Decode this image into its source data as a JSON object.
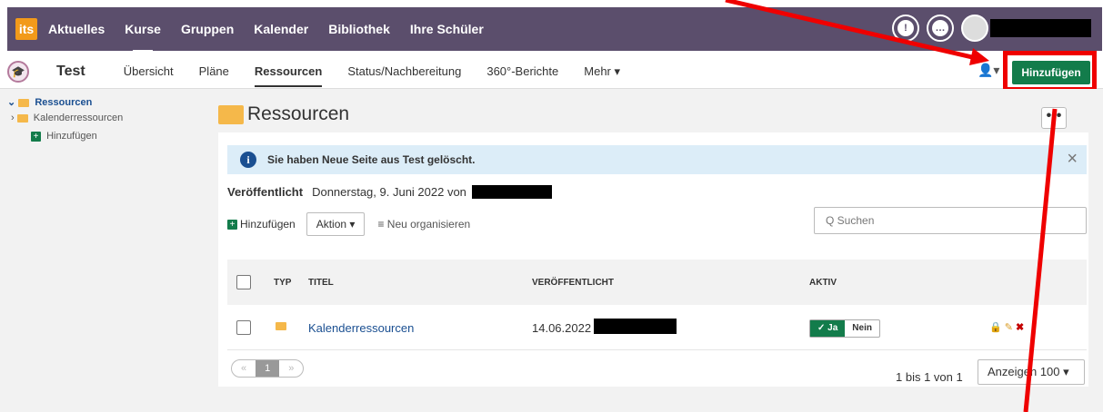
{
  "topnav": {
    "logo": "its",
    "items": [
      "Aktuelles",
      "Kurse",
      "Gruppen",
      "Kalender",
      "Bibliothek",
      "Ihre Schüler"
    ],
    "icons": [
      "bell-icon",
      "chat-icon"
    ]
  },
  "subnav": {
    "course_icon": "graduation-cap-icon",
    "course_title": "Test",
    "tabs": [
      "Übersicht",
      "Pläne",
      "Ressourcen",
      "Status/Nachbereitung",
      "360°-Berichte",
      "Mehr ▾"
    ],
    "active_tab": "Ressourcen",
    "user_menu": "user-dropdown-icon",
    "add_button": "Hinzufügen"
  },
  "sidebar": {
    "root": "Ressourcen",
    "child": "Kalenderressourcen",
    "add": "Hinzufügen"
  },
  "main": {
    "title": "Ressourcen",
    "more": "•••",
    "alert": "Sie haben Neue Seite aus Test gelöscht.",
    "alert_close": "×",
    "published_label": "Veröffentlicht",
    "published_text": "Donnerstag, 9. Juni 2022 von",
    "toolbar": {
      "add": "Hinzufügen",
      "action": "Aktion ▾",
      "reorg": "≡ Neu organisieren"
    },
    "search_placeholder": "Q  Suchen",
    "table": {
      "headers": [
        "TYP",
        "TITEL",
        "VERÖFFENTLICHT",
        "AKTIV"
      ],
      "row": {
        "title": "Kalenderressourcen",
        "published": "14.06.2022",
        "toggle_on": "✓ Ja",
        "toggle_off": "Nein"
      }
    },
    "pager": [
      "«",
      "1",
      "»"
    ],
    "counter": "1 bis 1 von 1",
    "pagesize": "Anzeigen 100 ▾"
  },
  "annotations": {
    "highlight_color": "#ef0000"
  }
}
